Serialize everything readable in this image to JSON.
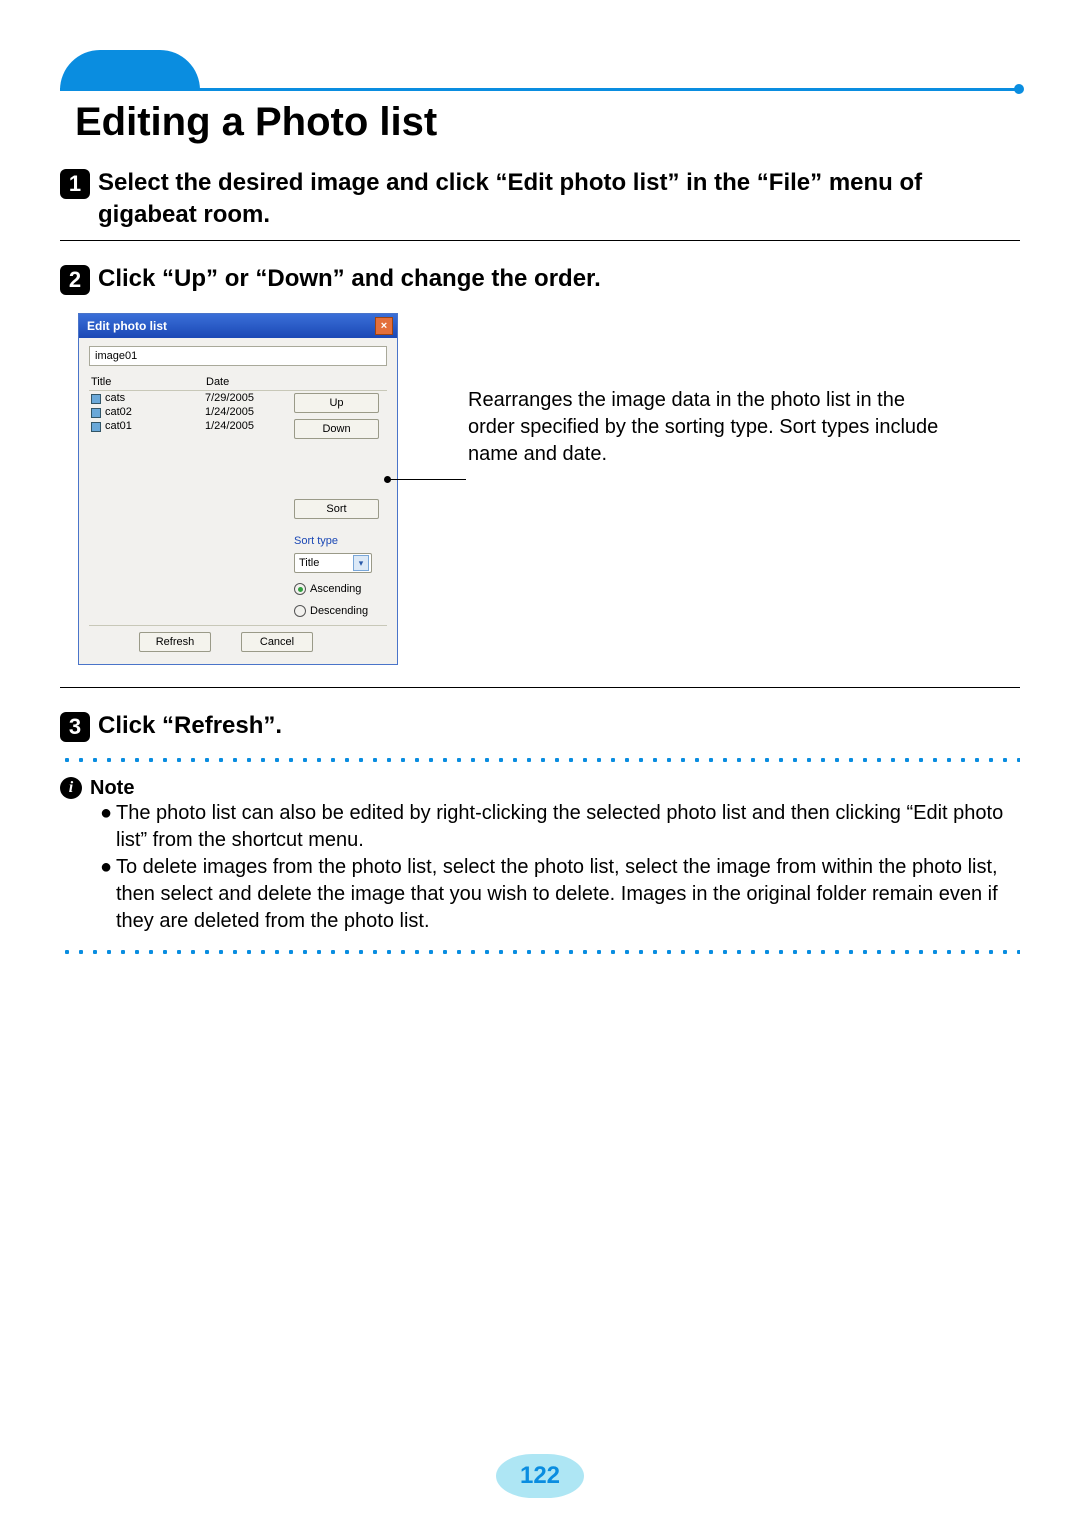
{
  "title": "Editing a Photo list",
  "steps": {
    "s1": {
      "num": "1",
      "text": "Select the desired image and click “Edit photo list” in the “File” menu of gigabeat room."
    },
    "s2": {
      "num": "2",
      "text": "Click “Up” or “Down” and change the order."
    },
    "s3": {
      "num": "3",
      "text": "Click “Refresh”."
    }
  },
  "dialog": {
    "title": "Edit photo list",
    "name_value": "image01",
    "headers": {
      "title": "Title",
      "date": "Date"
    },
    "rows": [
      {
        "title": "cats",
        "date": "7/29/2005"
      },
      {
        "title": "cat02",
        "date": "1/24/2005"
      },
      {
        "title": "cat01",
        "date": "1/24/2005"
      }
    ],
    "buttons": {
      "up": "Up",
      "down": "Down",
      "sort": "Sort"
    },
    "sort_type_label": "Sort type",
    "sort_type_value": "Title",
    "ascending": "Ascending",
    "descending": "Descending",
    "refresh": "Refresh",
    "cancel": "Cancel"
  },
  "callout": "Rearranges the image data in the photo list in the order specified by the sorting type. Sort types include name and date.",
  "note": {
    "label": "Note",
    "items": [
      "The photo list can also be edited by right-clicking the selected photo list and then clicking “Edit photo list” from the shortcut menu.",
      "To delete images from the photo list, select the photo list, select the image from within the photo list, then select and delete the image that you wish to delete. Images in the original folder remain even if they are deleted from the photo list."
    ]
  },
  "page_number": "122"
}
